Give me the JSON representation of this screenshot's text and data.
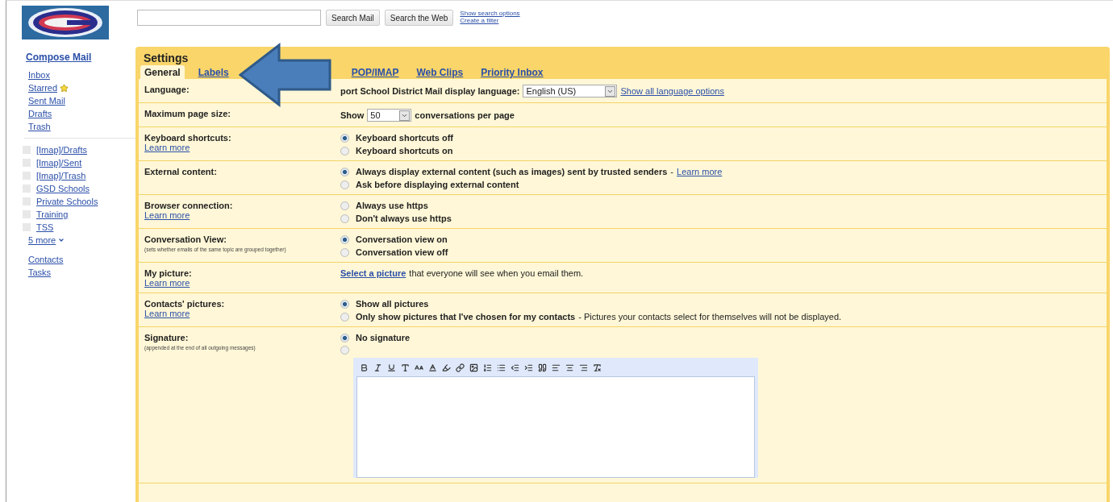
{
  "search": {
    "buttons": [
      "Search Mail",
      "Search the Web"
    ],
    "links": [
      "Show search options",
      "Create a filter"
    ]
  },
  "sidebar": {
    "compose": "Compose Mail",
    "mailboxes": [
      {
        "label": "Inbox",
        "starred": false
      },
      {
        "label": "Starred",
        "starred": true
      },
      {
        "label": "Sent Mail",
        "starred": false
      },
      {
        "label": "Drafts",
        "starred": false
      },
      {
        "label": "Trash",
        "starred": false
      }
    ],
    "labels": [
      "[Imap]/Drafts",
      "[Imap]/Sent",
      "[Imap]/Trash",
      "GSD Schools",
      "Private Schools",
      "Training",
      "TSS"
    ],
    "more": "5 more",
    "apps": [
      "Contacts",
      "Tasks"
    ]
  },
  "settings": {
    "title": "Settings",
    "tabs": [
      {
        "label": "General",
        "selected": true
      },
      {
        "label": "Labels",
        "selected": false
      },
      {
        "label": "POP/IMAP",
        "selected": false
      },
      {
        "label": "Web Clips",
        "selected": false
      },
      {
        "label": "Priority Inbox",
        "selected": false
      }
    ],
    "rows": [
      {
        "kind": "select",
        "label": "Language:",
        "before": "port School District Mail display language:",
        "value": "English (US)",
        "link": "Show all language options"
      },
      {
        "kind": "select",
        "label": "Maximum page size:",
        "before": "Show",
        "value": "50",
        "after": "conversations per page"
      },
      {
        "kind": "radio",
        "label": "Keyboard shortcuts:",
        "learn_more": "Learn more",
        "options": [
          {
            "text": "Keyboard shortcuts off",
            "selected": true
          },
          {
            "text": "Keyboard shortcuts on",
            "selected": false
          }
        ]
      },
      {
        "kind": "radio",
        "label": "External content:",
        "options": [
          {
            "text": "Always display external content (such as images) sent by trusted senders",
            "selected": true,
            "suffix": " - ",
            "link": "Learn more"
          },
          {
            "text": "Ask before displaying external content",
            "selected": false
          }
        ]
      },
      {
        "kind": "radio",
        "label": "Browser connection:",
        "learn_more": "Learn more",
        "options": [
          {
            "text": "Always use https",
            "selected": false
          },
          {
            "text": "Don't always use https",
            "selected": false
          }
        ]
      },
      {
        "kind": "radio",
        "label": "Conversation View:",
        "note": "(sets whether emails of the same topic are grouped together)",
        "options": [
          {
            "text": "Conversation view on",
            "selected": true
          },
          {
            "text": "Conversation view off",
            "selected": false
          }
        ]
      },
      {
        "kind": "link",
        "label": "My picture:",
        "learn_more": "Learn more",
        "link": "Select a picture",
        "after": "that everyone will see when you email them."
      },
      {
        "kind": "radio",
        "label": "Contacts' pictures:",
        "learn_more": "Learn more",
        "options": [
          {
            "text": "Show all pictures",
            "selected": true
          },
          {
            "text": "Only show pictures that I've chosen for my contacts",
            "selected": false,
            "suffix": "- Pictures your contacts select for themselves will not be displayed."
          }
        ]
      },
      {
        "kind": "signature",
        "label": "Signature:",
        "note": "(appended at the end of all outgoing messages)",
        "options": [
          {
            "text": "No signature",
            "selected": true
          },
          {
            "selected": false
          }
        ]
      }
    ]
  }
}
